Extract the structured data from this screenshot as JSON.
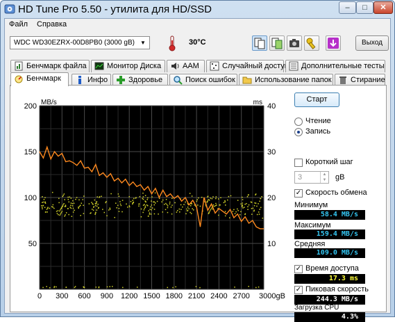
{
  "window": {
    "title": "HD Tune Pro 5.50 - утилита для HD/SSD",
    "minimize": "–",
    "maximize": "□",
    "close": "✕"
  },
  "menu": {
    "file": "Файл",
    "help": "Справка"
  },
  "toolbar": {
    "drive": "WDC    WD30EZRX-00D8PB0 (3000 gB)",
    "temperature": "30°C",
    "exit_label": "Выход"
  },
  "tabs_row1": [
    {
      "label": "Бенчмарк файла",
      "icon": "file-benchmark-icon"
    },
    {
      "label": "Монитор Диска",
      "icon": "disk-monitor-icon"
    },
    {
      "label": "AAM",
      "icon": "speaker-icon"
    },
    {
      "label": "Случайный доступ",
      "icon": "random-access-icon"
    },
    {
      "label": "Дополнительные тесты",
      "icon": "extra-tests-icon"
    }
  ],
  "tabs_row2": [
    {
      "label": "Бенчмарк",
      "icon": "benchmark-icon",
      "active": true
    },
    {
      "label": "Инфо",
      "icon": "info-icon"
    },
    {
      "label": "Здоровье",
      "icon": "health-icon"
    },
    {
      "label": "Поиск ошибок",
      "icon": "error-scan-icon"
    },
    {
      "label": "Использование папок",
      "icon": "folder-icon"
    },
    {
      "label": "Стирание",
      "icon": "erase-icon"
    }
  ],
  "controls": {
    "start": "Старт",
    "read": "Чтение",
    "write": "Запись",
    "short_step": "Короткий шаг",
    "step_value": "3",
    "step_unit": "gB",
    "transfer_rate": "Скорость обмена",
    "minimum_label": "Минимум",
    "minimum_value": "58.4 MB/s",
    "maximum_label": "Максимум",
    "maximum_value": "159.4 MB/s",
    "average_label": "Средняя",
    "average_value": "109.0 MB/s",
    "access_time": "Время доступа",
    "access_time_value": "17.3 ms",
    "burst_rate": "Пиковая скорость",
    "burst_rate_value": "244.3 MB/s",
    "cpu_label": "Загрузка CPU",
    "cpu_value": "4.3%"
  },
  "chart_data": {
    "type": "line",
    "left_unit": "MB/s",
    "right_unit": "ms",
    "ylim": [
      0,
      200
    ],
    "ylim_right": [
      0,
      40
    ],
    "yticks_left": [
      "200",
      "150",
      "100",
      "50"
    ],
    "yticks_right": [
      "40",
      "30",
      "20",
      "10"
    ],
    "xlim": [
      0,
      3000
    ],
    "xticks": [
      "0",
      "300",
      "600",
      "900",
      "1200",
      "1500",
      "1800",
      "2100",
      "2400",
      "2700",
      "3000gB"
    ],
    "grid": true,
    "background": "#000000",
    "series": [
      {
        "name": "Скорость обмена",
        "color": "#ff8a1f",
        "x": [
          0,
          50,
          100,
          150,
          200,
          250,
          300,
          350,
          400,
          450,
          500,
          550,
          600,
          650,
          700,
          750,
          800,
          850,
          900,
          950,
          1000,
          1050,
          1100,
          1150,
          1200,
          1250,
          1300,
          1350,
          1400,
          1450,
          1500,
          1550,
          1600,
          1650,
          1700,
          1750,
          1800,
          1850,
          1900,
          1950,
          2000,
          2050,
          2100,
          2150,
          2200,
          2250,
          2300,
          2350,
          2400,
          2450,
          2500,
          2550,
          2600,
          2650,
          2700,
          2750,
          2800,
          2850,
          2900,
          2950,
          3000
        ],
        "values": [
          150,
          143,
          155,
          142,
          150,
          145,
          148,
          139,
          140,
          138,
          135,
          140,
          132,
          133,
          128,
          136,
          124,
          127,
          122,
          126,
          118,
          121,
          116,
          120,
          113,
          117,
          112,
          114,
          108,
          112,
          104,
          110,
          100,
          108,
          101,
          104,
          99,
          102,
          96,
          100,
          92,
          97,
          90,
          68,
          100,
          86,
          93,
          83,
          88,
          85,
          82,
          87,
          78,
          82,
          74,
          79,
          72,
          75,
          68,
          66,
          66
        ]
      }
    ],
    "access_points_ms_band": [
      17,
      20
    ],
    "access_points_color": "#d4d42a"
  }
}
